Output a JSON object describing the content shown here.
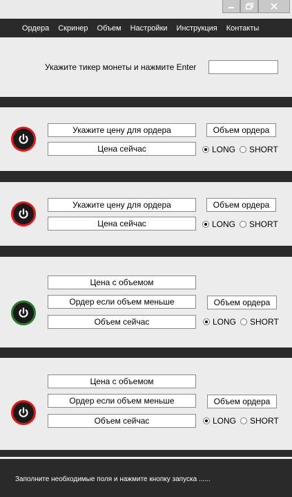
{
  "menu": [
    "Ордера",
    "Скринер",
    "Объем",
    "Настройки",
    "Инструкция",
    "Контакты"
  ],
  "ticker": {
    "label": "Укажите тикер монеты и нажмите Enter",
    "value": ""
  },
  "order_panels": [
    {
      "price_placeholder": "Укажите цену для ордера",
      "current_price": "Цена сейчас",
      "volume_button": "Объем ордера",
      "long": "LONG",
      "short": "SHORT",
      "selected": "LONG",
      "running": false
    },
    {
      "price_placeholder": "Укажите цену для ордера",
      "current_price": "Цена сейчас",
      "volume_button": "Объем ордера",
      "long": "LONG",
      "short": "SHORT",
      "selected": "LONG",
      "running": false
    }
  ],
  "volume_panels": [
    {
      "price_with_volume": "Цена с объемом",
      "order_if_volume_less": "Ордер если объем меньше",
      "current_volume": "Объем сейчас",
      "volume_button": "Объем ордера",
      "long": "LONG",
      "short": "SHORT",
      "selected": "LONG",
      "running": true
    },
    {
      "price_with_volume": "Цена с объемом",
      "order_if_volume_less": "Ордер если объем меньше",
      "current_volume": "Объем сейчас",
      "volume_button": "Объем ордера",
      "long": "LONG",
      "short": "SHORT",
      "selected": "LONG",
      "running": false
    }
  ],
  "status": "Заполните необходимые поля и нажмите кнопку запуска ......",
  "colors": {
    "stopped_ring": "#e01818",
    "running_ring": "#2a7a2a",
    "background": "#2a2a2a",
    "panel": "#ececec"
  }
}
